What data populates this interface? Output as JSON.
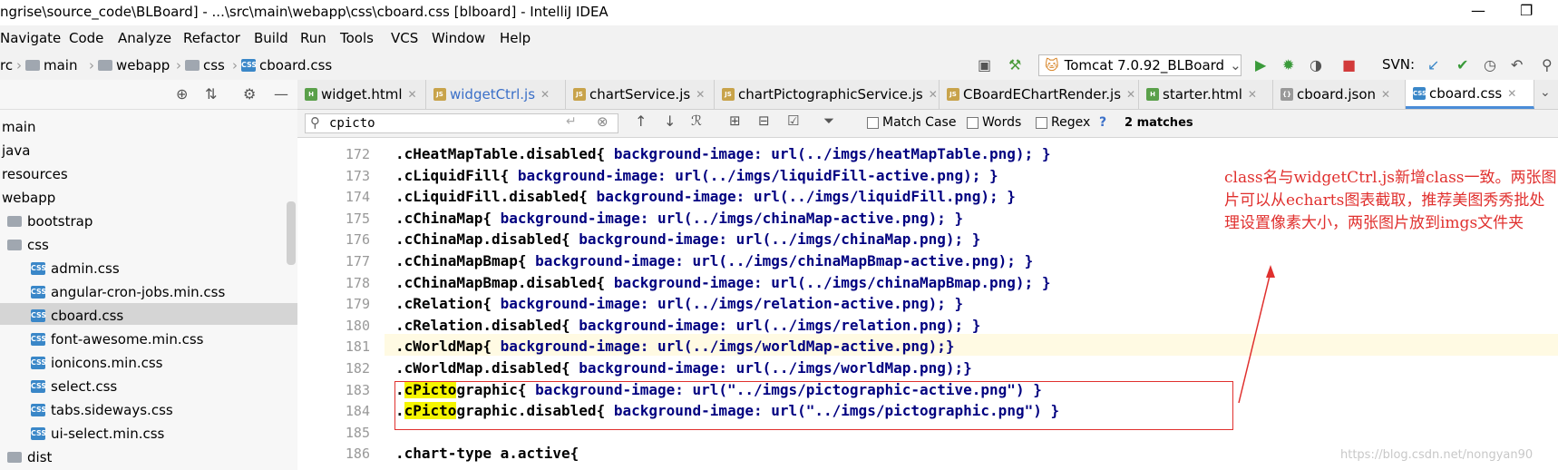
{
  "window": {
    "title": "ngrise\\source_code\\BLBoard] - ...\\src\\main\\webapp\\css\\cboard.css [blboard] - IntelliJ IDEA",
    "minimize": "—",
    "restore": "❐"
  },
  "menu": [
    "Navigate",
    "Code",
    "Analyze",
    "Refactor",
    "Build",
    "Run",
    "Tools",
    "VCS",
    "Window",
    "Help"
  ],
  "breadcrumb": [
    "rc",
    "main",
    "webapp",
    "css",
    "cboard.css"
  ],
  "run_config": "Tomcat 7.0.92_BLBoard",
  "svn_label": "SVN:",
  "project_tree": [
    {
      "label": "main",
      "indent": 0,
      "icon": "none"
    },
    {
      "label": "java",
      "indent": 0,
      "icon": "none"
    },
    {
      "label": "resources",
      "indent": 0,
      "icon": "none"
    },
    {
      "label": "webapp",
      "indent": 0,
      "icon": "none"
    },
    {
      "label": "bootstrap",
      "indent": 1,
      "icon": "folder"
    },
    {
      "label": "css",
      "indent": 1,
      "icon": "folder"
    },
    {
      "label": "admin.css",
      "indent": 2,
      "icon": "css"
    },
    {
      "label": "angular-cron-jobs.min.css",
      "indent": 2,
      "icon": "css"
    },
    {
      "label": "cboard.css",
      "indent": 2,
      "icon": "css",
      "selected": true
    },
    {
      "label": "font-awesome.min.css",
      "indent": 2,
      "icon": "css"
    },
    {
      "label": "ionicons.min.css",
      "indent": 2,
      "icon": "css"
    },
    {
      "label": "select.css",
      "indent": 2,
      "icon": "css"
    },
    {
      "label": "tabs.sideways.css",
      "indent": 2,
      "icon": "css"
    },
    {
      "label": "ui-select.min.css",
      "indent": 2,
      "icon": "css"
    },
    {
      "label": "dist",
      "indent": 1,
      "icon": "folder"
    }
  ],
  "tabs": [
    {
      "label": "widget.html",
      "icon": "H",
      "type": "h"
    },
    {
      "label": "widgetCtrl.js",
      "icon": "JS",
      "type": "js"
    },
    {
      "label": "chartService.js",
      "icon": "JS",
      "type": "js"
    },
    {
      "label": "chartPictographicService.js",
      "icon": "JS",
      "type": "js"
    },
    {
      "label": "CBoardEChartRender.js",
      "icon": "JS",
      "type": "js"
    },
    {
      "label": "starter.html",
      "icon": "H",
      "type": "h"
    },
    {
      "label": "cboard.json",
      "icon": "{}",
      "type": "json"
    },
    {
      "label": "cboard.css",
      "icon": "CSS",
      "type": "css",
      "active": true
    }
  ],
  "search": {
    "query": "cpicto",
    "match_case": "Match Case",
    "words": "Words",
    "regex": "Regex",
    "help": "?",
    "matches": "2 matches"
  },
  "code_lines": [
    {
      "num": "172",
      "sel": ".cHeatMapTable.disabled{",
      "rest": " background-image: url(../imgs/heatMapTable.png); }"
    },
    {
      "num": "173",
      "sel": ".cLiquidFill{",
      "rest": " background-image: url(../imgs/liquidFill-active.png); }"
    },
    {
      "num": "174",
      "sel": ".cLiquidFill.disabled{",
      "rest": " background-image: url(../imgs/liquidFill.png); }"
    },
    {
      "num": "175",
      "sel": ".cChinaMap{",
      "rest": " background-image: url(../imgs/chinaMap-active.png); }"
    },
    {
      "num": "176",
      "sel": ".cChinaMap.disabled{",
      "rest": " background-image: url(../imgs/chinaMap.png); }"
    },
    {
      "num": "177",
      "sel": ".cChinaMapBmap{",
      "rest": " background-image: url(../imgs/chinaMapBmap-active.png); }"
    },
    {
      "num": "178",
      "sel": ".cChinaMapBmap.disabled{",
      "rest": " background-image: url(../imgs/chinaMapBmap.png); }"
    },
    {
      "num": "179",
      "sel": ".cRelation{",
      "rest": " background-image: url(../imgs/relation-active.png); }"
    },
    {
      "num": "180",
      "sel": ".cRelation.disabled{",
      "rest": " background-image: url(../imgs/relation.png); }"
    },
    {
      "num": "181",
      "sel": ".cWorldMap{",
      "rest": " background-image: url(../imgs/worldMap-active.png);}"
    },
    {
      "num": "182",
      "sel": ".cWorldMap.disabled{",
      "rest": " background-image: url(../imgs/worldMap.png);}"
    },
    {
      "num": "183",
      "pre": ".",
      "hl": "cPicto",
      "sel": "graphic{",
      "rest": " background-image: url(\"../imgs/pictographic-active.png\") }"
    },
    {
      "num": "184",
      "pre": ".",
      "hl": "cPicto",
      "sel": "graphic.disabled{",
      "rest": " background-image: url(\"../imgs/pictographic.png\") }"
    },
    {
      "num": "185",
      "sel": "",
      "rest": ""
    },
    {
      "num": "186",
      "sel": ".chart-type a.active{",
      "rest": ""
    }
  ],
  "annotation": "class名与widgetCtrl.js新增class一致。两张图片可以从echarts图表截取，推荐美图秀秀批处理设置像素大小，两张图片放到imgs文件夹",
  "watermark": "https://blog.csdn.net/nongyan90",
  "colors": {
    "annotation_red": "#e0302e",
    "search_highlight": "#f5f500",
    "active_tab_underline": "#4a8cd8"
  }
}
